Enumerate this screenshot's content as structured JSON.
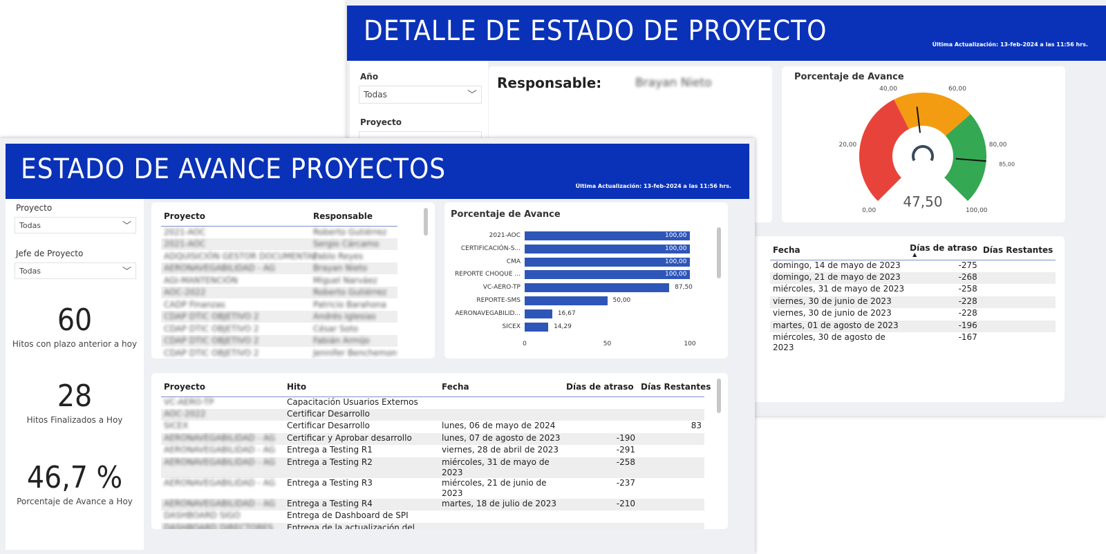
{
  "detalle": {
    "title": "DETALLE DE ESTADO DE PROYECTO",
    "updated": "Última Actualización: 13-feb-2024 a las 11:56 hrs.",
    "filters": {
      "year_label": "Año",
      "year_value": "Todas",
      "project_label": "Proyecto"
    },
    "responsable_label": "Responsable:",
    "responsable_value": "Brayan Nieto",
    "gauge": {
      "title": "Porcentaje de Avance",
      "value": 47.5,
      "value_label": "47,50",
      "target": 85,
      "ticks": [
        "0,00",
        "20,00",
        "40,00",
        "60,00",
        "80,00",
        "85,00",
        "100,00"
      ],
      "colors": {
        "low": "#e8433a",
        "mid": "#f39c12",
        "high": "#34a853"
      }
    },
    "table": {
      "headers": [
        "Fecha",
        "Días de atraso",
        "Días Restantes"
      ],
      "rows": [
        [
          "domingo, 14 de mayo de 2023",
          "-275",
          ""
        ],
        [
          "domingo, 21 de mayo de 2023",
          "-268",
          ""
        ],
        [
          "miércoles, 31 de mayo de 2023",
          "-258",
          ""
        ],
        [
          "viernes, 30 de junio de 2023",
          "-228",
          ""
        ],
        [
          "viernes, 30 de junio de 2023",
          "-228",
          ""
        ],
        [
          "martes, 01 de agosto de 2023",
          "-196",
          ""
        ],
        [
          "miércoles, 30 de agosto de 2023",
          "-167",
          ""
        ]
      ]
    }
  },
  "avance": {
    "title": "ESTADO DE AVANCE PROYECTOS",
    "updated": "Última Actualización: 13-feb-2024 a las 11:56 hrs.",
    "filters": {
      "project_label": "Proyecto",
      "project_value": "Todas",
      "jefe_label": "Jefe de Proyecto",
      "jefe_value": "Todas"
    },
    "kpis": [
      {
        "value": "60",
        "label": "Hitos con plazo anterior a hoy"
      },
      {
        "value": "28",
        "label": "Hitos Finalizados a Hoy"
      },
      {
        "value": "46,7 %",
        "label": "Porcentaje de Avance a Hoy"
      }
    ],
    "proj_table": {
      "headers": [
        "Proyecto",
        "Responsable"
      ],
      "rows": [
        [
          "2021-AOC",
          "Roberto Gutiérrez"
        ],
        [
          "2021-AOC",
          "Sergio Cárcamo"
        ],
        [
          "ADQUISICIÓN GESTOR DOCUMENTAL",
          "Pablo Reyes"
        ],
        [
          "AERONAVEGABILIDAD - AG",
          "Brayan Nieto"
        ],
        [
          "AGI-MANTENCIÓN",
          "Miguel Narváez"
        ],
        [
          "AOC-2022",
          "Roberto Gutiérrez"
        ],
        [
          "CADP Finanzas",
          "Patricio Barahona"
        ],
        [
          "CDAP DTIC OBJETIVO 2",
          "Andrés Iglesias"
        ],
        [
          "CDAP DTIC OBJETIVO 2",
          "César Soto"
        ],
        [
          "CDAP DTIC OBJETIVO 2",
          "Fabián Armijo"
        ],
        [
          "CDAP DTIC OBJETIVO 2",
          "Jennifer Benchemon"
        ]
      ]
    },
    "chart_data": {
      "type": "bar",
      "title": "Porcentaje de Avance",
      "categories": [
        "2021-AOC",
        "CERTIFICACIÓN-S...",
        "CMA",
        "REPORTE CHOQUE ...",
        "VC-AERO-TP",
        "REPORTE-SMS",
        "AERONAVEGABILID...",
        "SICEX"
      ],
      "values": [
        100,
        100,
        100,
        100,
        87.5,
        50,
        16.67,
        14.29
      ],
      "value_labels": [
        "100,00",
        "100,00",
        "100,00",
        "100,00",
        "87,50",
        "50,00",
        "16,67",
        "14,29"
      ],
      "xticks": [
        "0",
        "50",
        "100"
      ],
      "xlim": [
        0,
        100
      ],
      "bar_color": "#2e56b8"
    },
    "hitos_table": {
      "headers": [
        "Proyecto",
        "Hito",
        "Fecha",
        "Días de atraso",
        "Días Restantes"
      ],
      "rows": [
        [
          "VC-AERO-TP",
          "Capacitación Usuarios Externos",
          "",
          "",
          ""
        ],
        [
          "AOC-2022",
          "Certificar Desarrollo",
          "",
          "",
          ""
        ],
        [
          "SICEX",
          "Certificar Desarrollo",
          "lunes, 06 de mayo de 2024",
          "",
          "83"
        ],
        [
          "AERONAVEGABILIDAD - AG",
          "Certificar y Aprobar desarrollo",
          "lunes, 07 de agosto de 2023",
          "-190",
          ""
        ],
        [
          "AERONAVEGABILIDAD - AG",
          "Entrega a Testing R1",
          "viernes, 28 de abril de 2023",
          "-291",
          ""
        ],
        [
          "AERONAVEGABILIDAD - AG",
          "Entrega a Testing R2",
          "miércoles, 31 de mayo de 2023",
          "-258",
          ""
        ],
        [
          "AERONAVEGABILIDAD - AG",
          "Entrega a Testing R3",
          "miércoles, 21 de junio de 2023",
          "-237",
          ""
        ],
        [
          "AERONAVEGABILIDAD - AG",
          "Entrega a Testing R4",
          "martes, 18 de julio de 2023",
          "-210",
          ""
        ],
        [
          "DASHBOARD SIGO",
          "Entrega de Dashboard de SPI",
          "",
          "",
          ""
        ],
        [
          "DASHBOARD DIRECTORES",
          "Entrega de la actualización del",
          "",
          "",
          ""
        ]
      ]
    }
  }
}
